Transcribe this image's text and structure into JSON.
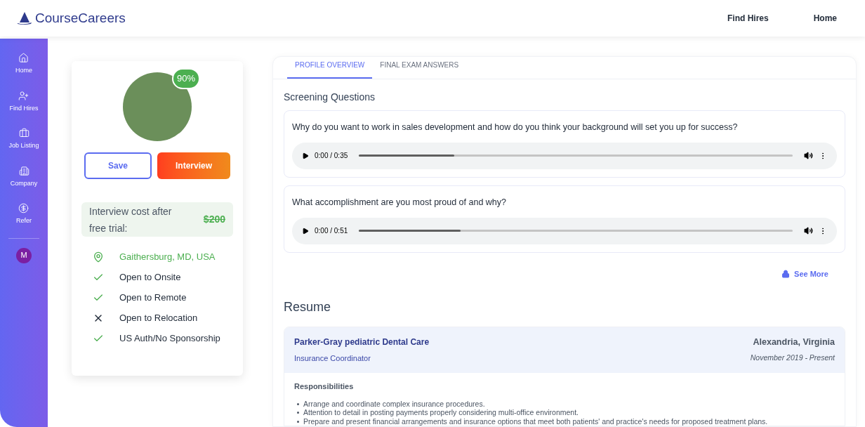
{
  "header": {
    "brand": "CourseCareers",
    "nav": [
      {
        "label": "Find Hires"
      },
      {
        "label": "Home"
      }
    ]
  },
  "sidebar": {
    "items": [
      {
        "label": "Home"
      },
      {
        "label": "Find Hires"
      },
      {
        "label": "Job Listing"
      },
      {
        "label": "Company"
      },
      {
        "label": "Refer"
      }
    ],
    "avatar": "M"
  },
  "profile": {
    "match": "90%",
    "buttons": [
      {
        "label": "Save",
        "kind": "outline"
      },
      {
        "label": "Interview",
        "kind": "primary"
      }
    ],
    "cost": {
      "label": "Interview cost after free trial:",
      "price": "$200"
    },
    "facts": [
      {
        "kind": "location",
        "text": "Gaithersburg, MD, USA"
      },
      {
        "kind": "yes",
        "text": "Open to Onsite"
      },
      {
        "kind": "yes",
        "text": "Open to Remote"
      },
      {
        "kind": "no",
        "text": "Open to Relocation"
      },
      {
        "kind": "yes",
        "text": "US Auth/No Sponsorship"
      }
    ]
  },
  "tabs": [
    {
      "label": "PROFILE OVERVIEW",
      "selected": true
    },
    {
      "label": "FINAL EXAM ANSWERS",
      "selected": false
    }
  ],
  "screening": {
    "title": "Screening Questions",
    "questions": [
      {
        "question": "Why do you want to work in sales development and how do you think your background will set you up for success?",
        "time": "0:00 / 0:35",
        "level": 0.22
      },
      {
        "question": "What accomplishment are you most proud of and why?",
        "time": "0:00 / 0:51",
        "level": 0.235
      }
    ],
    "see_more": "See More"
  },
  "resume": {
    "title": "Resume",
    "jobs": [
      {
        "company": "Parker-Gray pediatric Dental Care",
        "role": "Insurance Coordinator",
        "location": "Alexandria, Virginia",
        "dates": "November 2019 - Present",
        "section": "Responsibilities",
        "bullets": [
          "Arrange and coordinate complex insurance procedures.",
          "Attention to detail in posting payments properly considering multi-office environment.",
          "Prepare and present financial arrangements and insurance options that meet both patients' and practice's needs for proposed treatment plans."
        ]
      }
    ]
  }
}
